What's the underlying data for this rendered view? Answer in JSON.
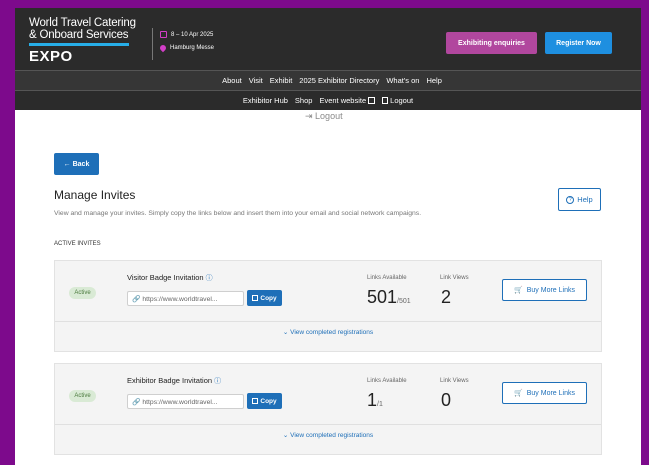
{
  "header": {
    "logo_line1": "World Travel Catering",
    "logo_line2": "& Onboard Services",
    "logo_line3": "EXPO",
    "dates": "8 – 10 Apr 2025",
    "venue": "Hamburg Messe",
    "exhibiting_btn": "Exhibiting enquiries",
    "register_btn": "Register Now"
  },
  "nav_main": [
    "About",
    "Visit",
    "Exhibit",
    "2025 Exhibitor Directory",
    "What's on",
    "Help"
  ],
  "nav_sub": [
    "Exhibitor Hub",
    "Shop",
    "Event website",
    "Logout"
  ],
  "ghost_logout": "Logout",
  "page": {
    "back": "← Back",
    "title": "Manage Invites",
    "description": "View and manage your invites. Simply copy the links below and insert them into your email and social network campaigns.",
    "help": "Help",
    "section": "ACTIVE INVITES"
  },
  "invites": [
    {
      "status": "Active",
      "title": "Visitor Badge Invitation",
      "url": "https://www.worldtravel...",
      "copy": "Copy",
      "links_available_label": "Links Available",
      "links_available": "501",
      "links_total": "/501",
      "link_views_label": "Link Views",
      "link_views": "2",
      "buy_more": "Buy More Links",
      "view_completed": "View completed registrations"
    },
    {
      "status": "Active",
      "title": "Exhibitor Badge Invitation",
      "url": "https://www.worldtravel...",
      "copy": "Copy",
      "links_available_label": "Links Available",
      "links_available": "1",
      "links_total": "/1",
      "link_views_label": "Link Views",
      "link_views": "0",
      "buy_more": "Buy More Links",
      "view_completed": "View completed registrations"
    }
  ],
  "colors": {
    "frame": "#7d0a8c",
    "header_bg": "#2b2b2b",
    "primary": "#1e6fb8",
    "exhibiting": "#b1479e",
    "register": "#1e8fe0"
  }
}
